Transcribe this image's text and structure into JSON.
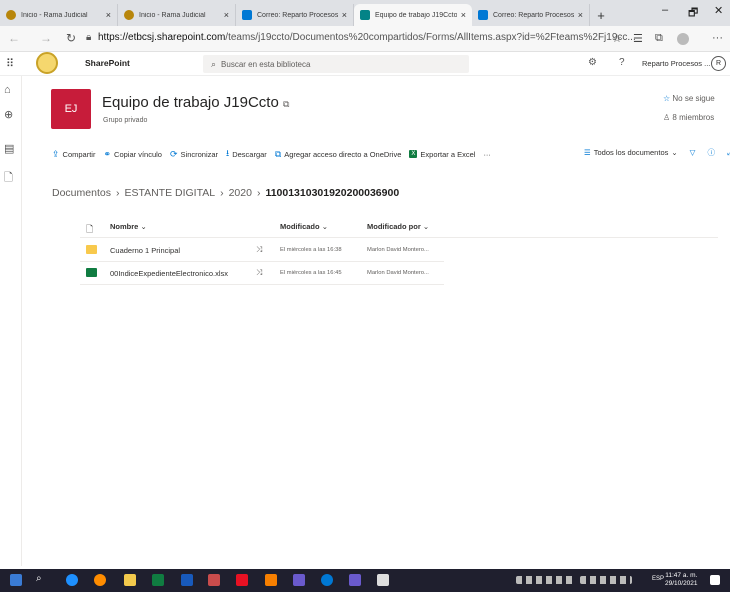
{
  "browser": {
    "tabs": [
      {
        "title": "Inicio - Rama Judicial",
        "color": "#b8860b",
        "active": false
      },
      {
        "title": "Inicio - Rama Judicial",
        "color": "#b8860b",
        "active": false
      },
      {
        "title": "Correo: Reparto Procesos C",
        "color": "#0078d4",
        "active": false
      },
      {
        "title": "Equipo de trabajo J19Ccto",
        "color": "#038387",
        "active": true
      },
      {
        "title": "Correo: Reparto Procesos C",
        "color": "#0078d4",
        "active": false
      }
    ],
    "tab_close": "×",
    "new_tab": "+",
    "window_controls": {
      "minimize": "–",
      "maximize": "🗗",
      "close": "✕"
    },
    "url_host": "https://etbcsj.sharepoint.com",
    "url_path": "/teams/j19ccto/Documentos%20compartidos/Forms/AllItems.aspx?id=%2Fteams%2Fj19cc...",
    "nav_icons": [
      "back-arrow-icon",
      "forward-arrow-icon",
      "refresh-icon",
      "lock-icon"
    ],
    "toolbar_icons": [
      "favorite-star-icon",
      "favorites-list-icon",
      "collections-icon",
      "profile-icon",
      "more-icon"
    ]
  },
  "suite": {
    "app_name": "SharePoint",
    "search_placeholder": "Buscar en esta biblioteca",
    "settings_glyph": "⚙",
    "help_glyph": "?",
    "account_name": "Reparto Procesos ...",
    "account_initial": "R"
  },
  "site": {
    "logo_initials": "EJ",
    "logo_color": "#c71c3a",
    "title": "Equipo de trabajo J19Ccto",
    "subtitle": "Grupo privado",
    "follow": "No se sigue",
    "members": "8 miembros"
  },
  "commands": [
    {
      "label": "Compartir",
      "icon": "share-icon",
      "glyph": "⇪"
    },
    {
      "label": "Copiar vínculo",
      "icon": "link-icon",
      "glyph": "⚭"
    },
    {
      "label": "Sincronizar",
      "icon": "sync-icon",
      "glyph": "⟳"
    },
    {
      "label": "Descargar",
      "icon": "download-icon",
      "glyph": "⭳"
    },
    {
      "label": "Agregar acceso directo a OneDrive",
      "icon": "shortcut-icon",
      "glyph": "⧉"
    },
    {
      "label": "Exportar a Excel",
      "icon": "excel-icon",
      "glyph": "X"
    }
  ],
  "command_more": "···",
  "view_selector": "Todos los documentos",
  "breadcrumb": [
    "Documentos",
    "ESTANTE DIGITAL",
    "2020"
  ],
  "breadcrumb_current": "11001310301920200036900",
  "columns": {
    "name": "Nombre",
    "modified": "Modificado",
    "modified_by": "Modificado por"
  },
  "rows": [
    {
      "name": "Cuaderno 1 Principal",
      "type": "folder",
      "modified": "El miércoles a las 16:38",
      "modified_by": "Marlon David Montero..."
    },
    {
      "name": "00IndiceExpedienteElectronico.xlsx",
      "type": "xlsx",
      "modified": "El miércoles a las 16:45",
      "modified_by": "Marlon David Montero..."
    }
  ],
  "taskbar": {
    "time": "11:47 a. m.",
    "date": "29/10/2021",
    "lang": "ESP"
  }
}
